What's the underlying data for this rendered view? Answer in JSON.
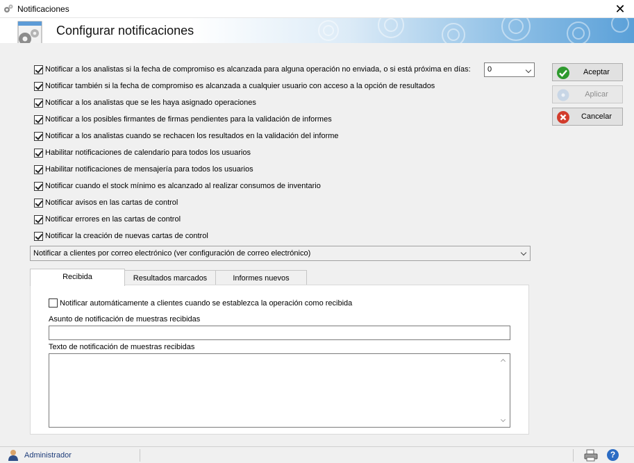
{
  "window": {
    "title": "Notificaciones"
  },
  "header": {
    "title": "Configurar notificaciones"
  },
  "options": [
    {
      "label": "Notificar a los analistas si la fecha de compromiso es alcanzada para alguna operación no enviada, o si está próxima en días:",
      "checked": true
    },
    {
      "label": "Notificar también si la fecha de compromiso es alcanzada a cualquier usuario con acceso a la opción de resultados",
      "checked": true
    },
    {
      "label": "Notificar a los analistas que se les haya asignado operaciones",
      "checked": true
    },
    {
      "label": "Notificar a los posibles firmantes de firmas pendientes para la validación de informes",
      "checked": true
    },
    {
      "label": "Notificar a los analistas cuando se rechacen los resultados en la validación del informe",
      "checked": true
    },
    {
      "label": "Habilitar notificaciones de calendario para todos los usuarios",
      "checked": true
    },
    {
      "label": "Habilitar notificaciones de mensajería para todos los usuarios",
      "checked": true
    },
    {
      "label": "Notificar cuando el stock mínimo es alcanzado al realizar consumos de inventario",
      "checked": true
    },
    {
      "label": "Notificar avisos en las cartas de control",
      "checked": true
    },
    {
      "label": "Notificar errores en las cartas de control",
      "checked": true
    },
    {
      "label": "Notificar la creación de nuevas cartas de control",
      "checked": true
    }
  ],
  "days_select": {
    "value": "0"
  },
  "buttons": {
    "accept": "Aceptar",
    "apply": "Aplicar",
    "cancel": "Cancelar"
  },
  "client_select": {
    "value": "Notificar a clientes por correo electrónico (ver configuración de correo electrónico)"
  },
  "tabs": [
    {
      "label": "Recibida",
      "active": true
    },
    {
      "label": "Resultados marcados",
      "active": false
    },
    {
      "label": "Informes nuevos",
      "active": false
    }
  ],
  "panel": {
    "auto_notify_label": "Notificar automáticamente a clientes cuando se establezca la operación como recibida",
    "auto_notify_checked": false,
    "subject_label": "Asunto de notificación de muestras recibidas",
    "subject_value": "",
    "body_label": "Texto de notificación de muestras recibidas",
    "body_value": ""
  },
  "status": {
    "user": "Administrador"
  }
}
